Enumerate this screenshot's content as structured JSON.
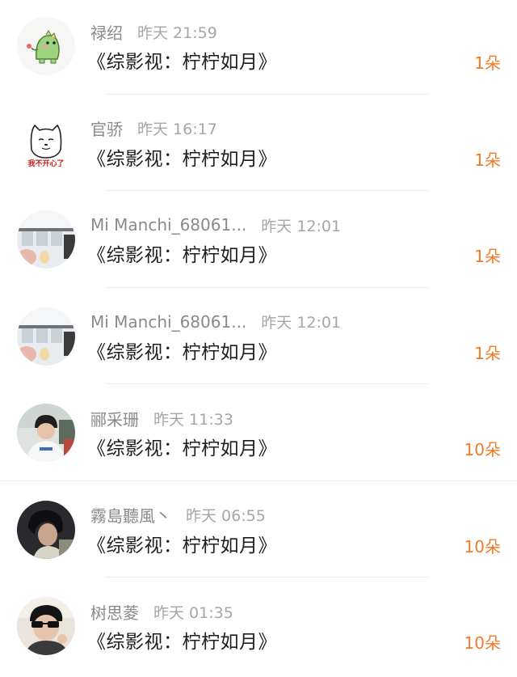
{
  "items": [
    {
      "name": "禄绍",
      "time": "昨天 21:59",
      "title": "《综影视：柠柠如月》",
      "count": "1朵",
      "avatar": "dinosaur-sticker"
    },
    {
      "name": "官骄",
      "time": "昨天 16:17",
      "title": "《综影视：柠柠如月》",
      "count": "1朵",
      "avatar": "cat-meme",
      "avatar_caption": "我不开心了"
    },
    {
      "name": "Mi Manchi_68061...",
      "time": "昨天 12:01",
      "title": "《综影视：柠柠如月》",
      "count": "1朵",
      "avatar": "window-photo"
    },
    {
      "name": "Mi Manchi_68061...",
      "time": "昨天 12:01",
      "title": "《综影视：柠柠如月》",
      "count": "1朵",
      "avatar": "window-photo"
    },
    {
      "name": "郦采珊",
      "time": "昨天 11:33",
      "title": "《综影视：柠柠如月》",
      "count": "10朵",
      "avatar": "person-cap-photo"
    },
    {
      "name": "霧島聽風丶",
      "time": "昨天 06:55",
      "title": "《综影视：柠柠如月》",
      "count": "10朵",
      "avatar": "dark-portrait-photo"
    },
    {
      "name": "树思菱",
      "time": "昨天 01:35",
      "title": "《综影视：柠柠如月》",
      "count": "10朵",
      "avatar": "sunglasses-photo"
    }
  ],
  "colors": {
    "count_orange": "#f27a26",
    "name_gray": "#8a8a8a",
    "time_gray": "#a6a6a6",
    "title_dark": "#1e1e1e"
  }
}
